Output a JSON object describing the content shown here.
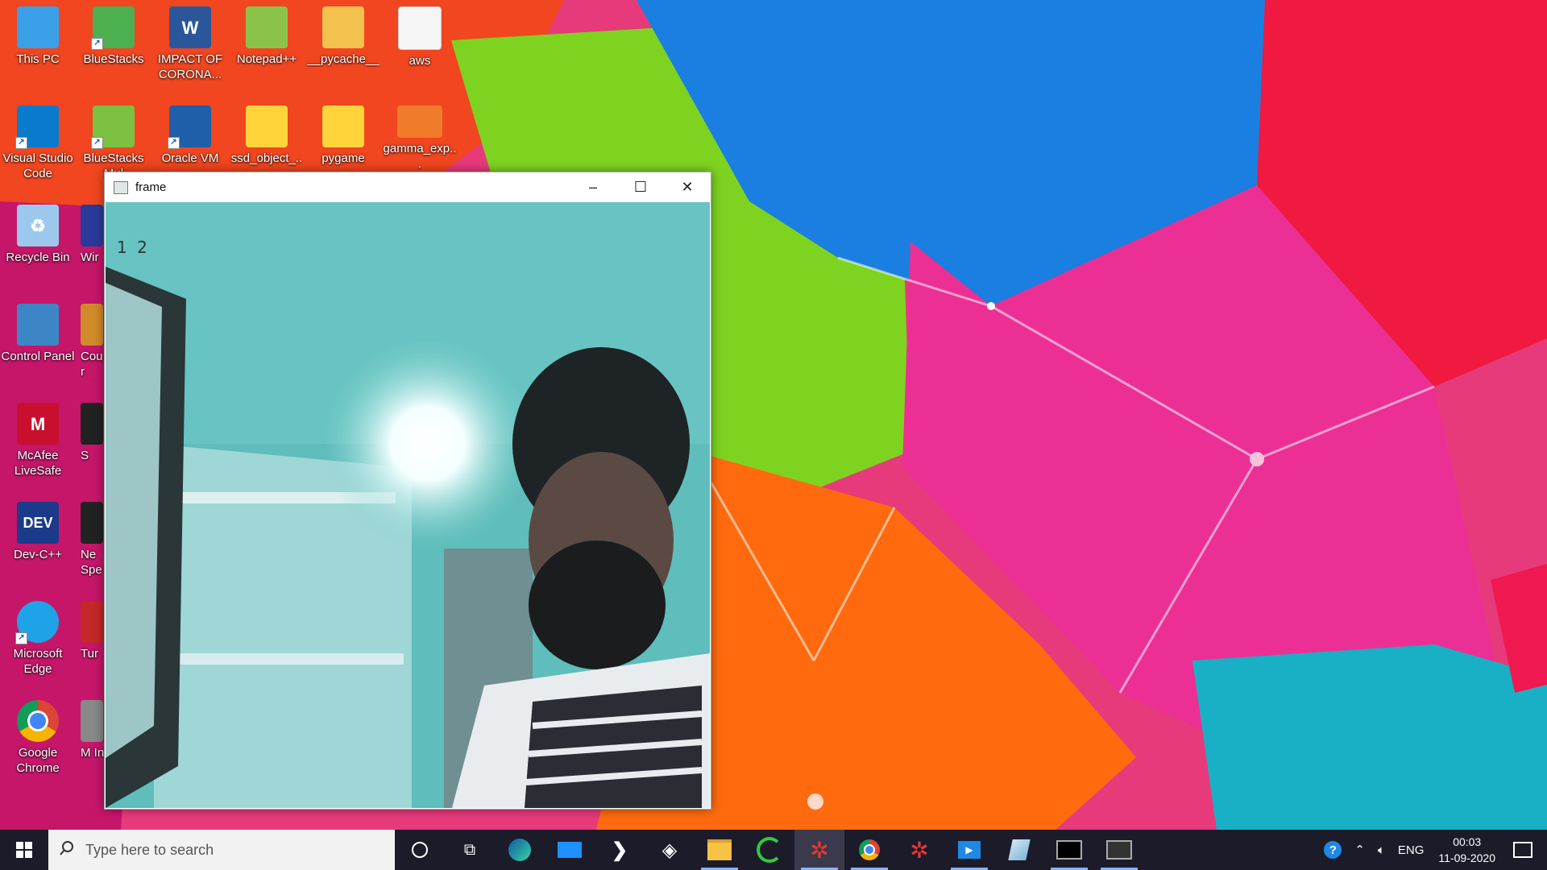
{
  "desktop": {
    "icons": [
      {
        "label": "This PC",
        "color": "#3aa0e8"
      },
      {
        "label": "BlueStacks",
        "color": "#4caf50"
      },
      {
        "label": "IMPACT OF CORONA...",
        "color": "#2b579a",
        "glyph": "W"
      },
      {
        "label": "Notepad++",
        "color": "#8bc34a"
      },
      {
        "label": "__pycache__",
        "color": "#f2c14e"
      },
      {
        "label": "aws",
        "color": "#f5f5f5"
      },
      {
        "label": "Visual Studio Code",
        "color": "#0a7acc"
      },
      {
        "label": "BlueStacks Mul",
        "color": "#7cc142"
      },
      {
        "label": "Oracle VM",
        "color": "#1f5ea8"
      },
      {
        "label": "ssd_object_...",
        "color": "#ffd43b"
      },
      {
        "label": "pygame",
        "color": "#ffd43b"
      },
      {
        "label": "gamma_exp...",
        "color": "#f07b2a"
      },
      {
        "label": "Recycle Bin",
        "color": "#9cc8ee"
      },
      {
        "label": "Wir",
        "color": "#2a3a9a"
      },
      {
        "label": "Control Panel",
        "color": "#3d86c6"
      },
      {
        "label": "Cour Glob",
        "color": "#d18a2b"
      },
      {
        "label": "McAfee LiveSafe",
        "color": "#c8102e",
        "glyph": "M"
      },
      {
        "label": "S",
        "color": "#222"
      },
      {
        "label": "Dev-C++",
        "color": "#1b3a8a",
        "glyph": "DEV"
      },
      {
        "label": "Ne Spee",
        "color": "#222"
      },
      {
        "label": "Microsoft Edge",
        "color": "#1fa3e8"
      },
      {
        "label": "Tur",
        "color": "#c62828"
      },
      {
        "label": "Google Chrome",
        "color": "#db4437"
      },
      {
        "label": "M In",
        "color": "#888"
      }
    ]
  },
  "window": {
    "title": "frame",
    "minimize": "–",
    "maximize": "☐",
    "close": "✕",
    "counter_text": "1 2"
  },
  "taskbar": {
    "search_placeholder": "Type here to search",
    "items": [
      {
        "name": "cortana-icon"
      },
      {
        "name": "task-view-icon"
      },
      {
        "name": "edge-icon"
      },
      {
        "name": "mail-icon"
      },
      {
        "name": "powershell-icon"
      },
      {
        "name": "dropbox-icon"
      },
      {
        "name": "file-explorer-icon"
      },
      {
        "name": "spinner-app-icon"
      },
      {
        "name": "opencv-app-icon"
      },
      {
        "name": "chrome-icon"
      },
      {
        "name": "opencv-app-2-icon"
      },
      {
        "name": "media-player-icon"
      },
      {
        "name": "virtualbox-icon"
      },
      {
        "name": "terminal-icon"
      },
      {
        "name": "console-icon"
      }
    ],
    "tray": {
      "language": "ENG",
      "time": "00:03",
      "date": "11-09-2020"
    }
  }
}
